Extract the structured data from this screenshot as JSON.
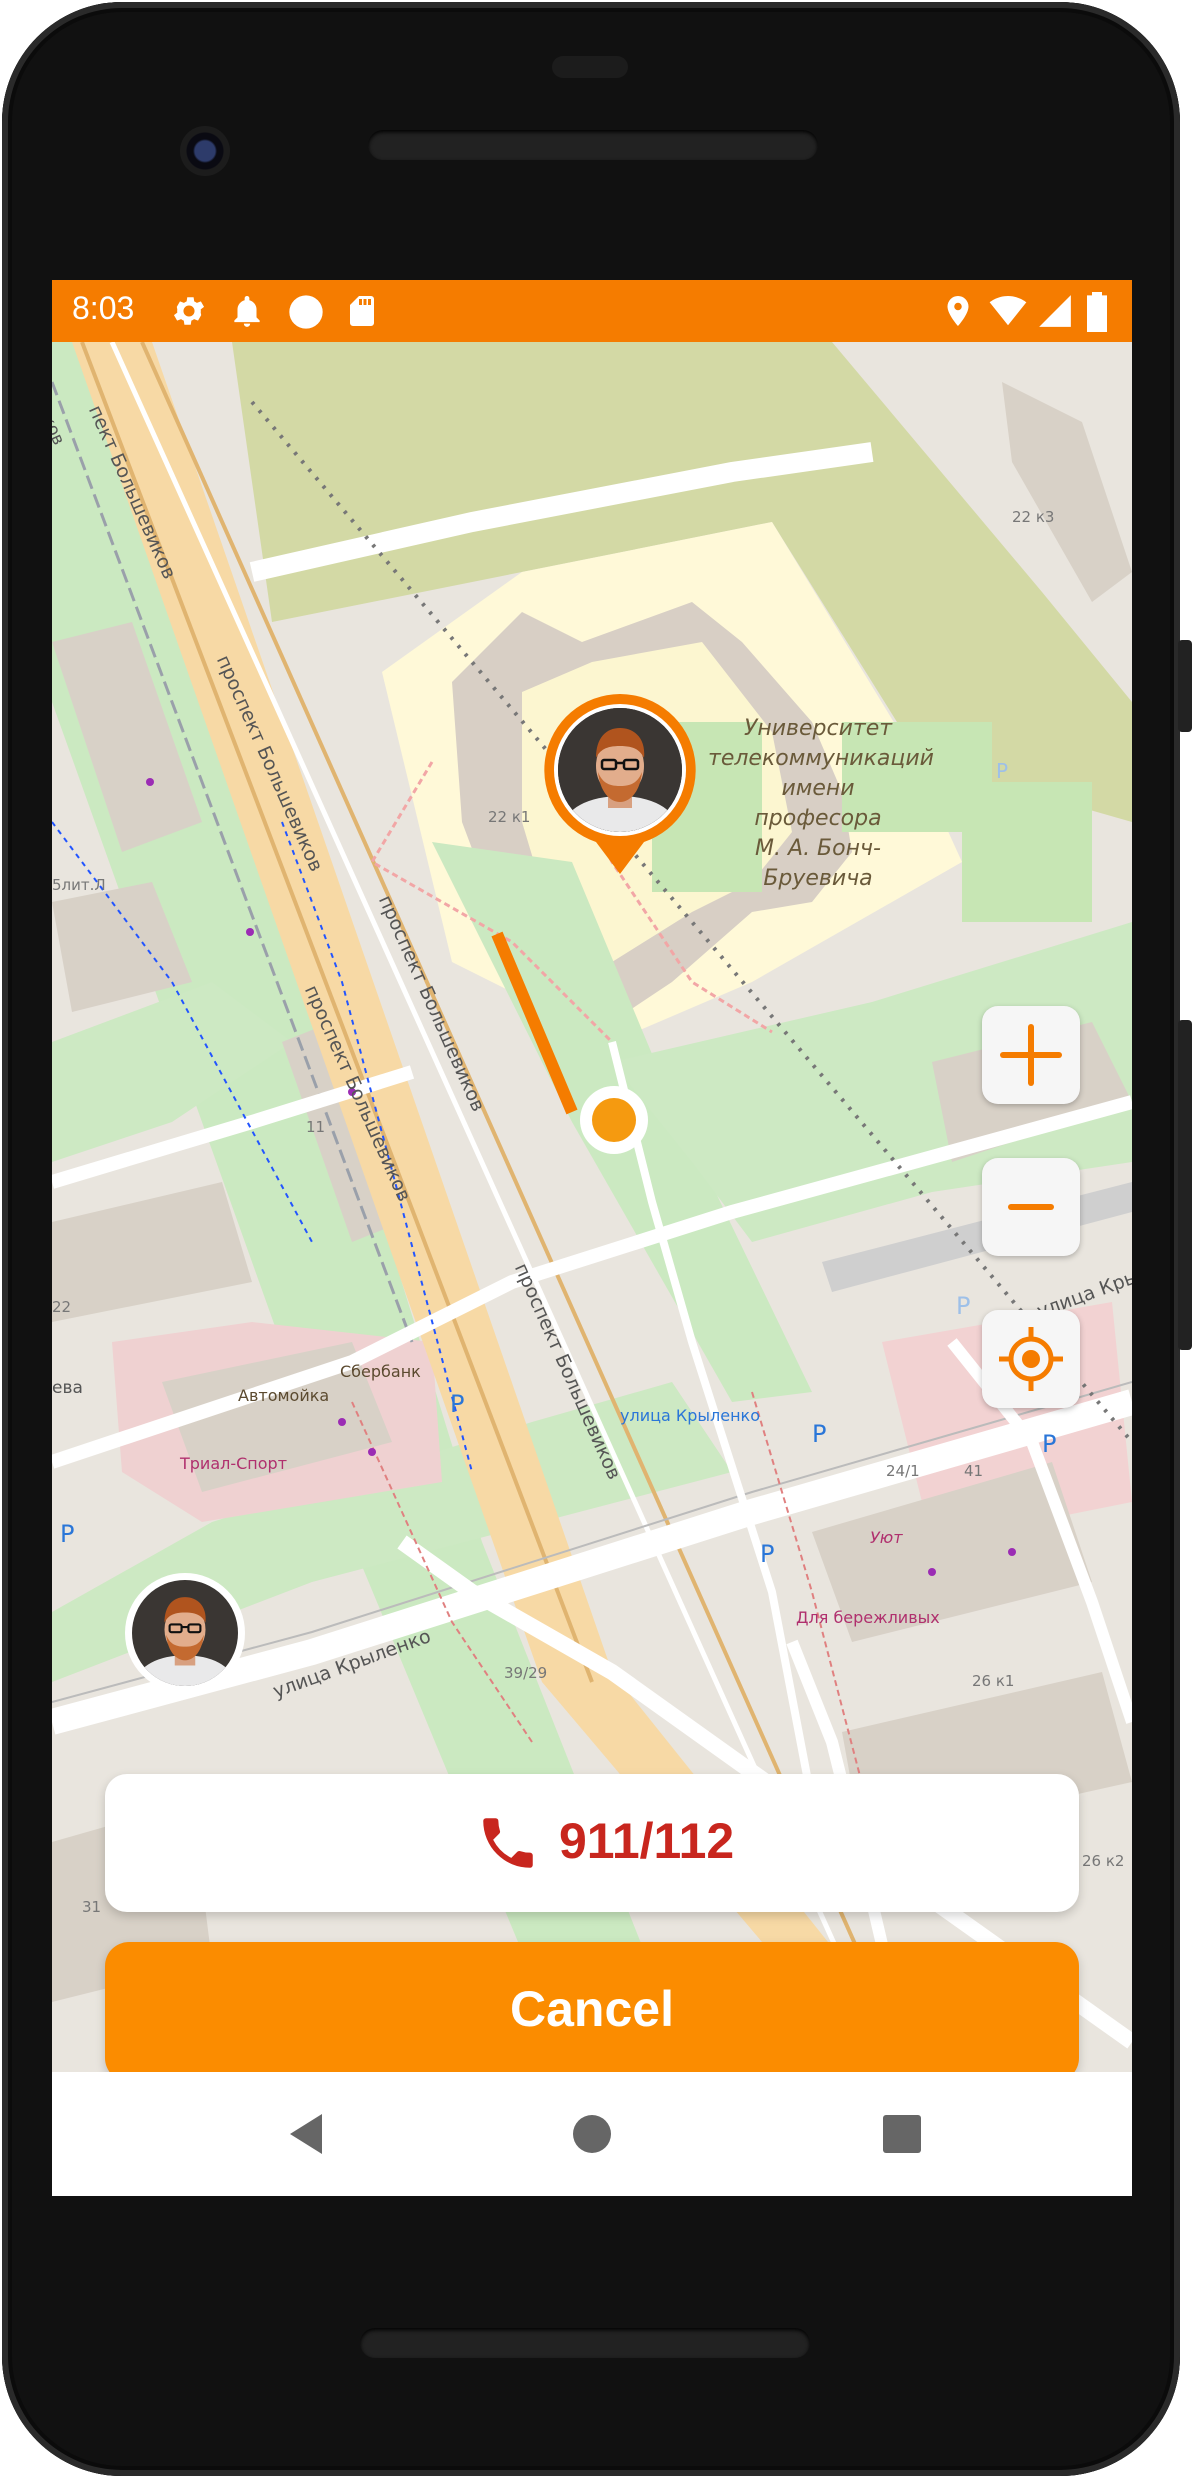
{
  "status_bar": {
    "time": "8:03",
    "left_icons": [
      "gear-icon",
      "bell-icon",
      "circle-icon",
      "sd-card-icon"
    ],
    "right_icons": [
      "location-icon",
      "wifi-icon",
      "signal-icon",
      "battery-icon"
    ],
    "background_color": "#f57c00"
  },
  "map": {
    "poi_university": [
      "Университет",
      "телекоммуникаций",
      "имени",
      "професора",
      "М. А. Бонч-",
      "Бруевича"
    ],
    "street_labels": {
      "prospekt_1": "проспект Большевиков",
      "prospekt_2": "проспект Большевиков",
      "prospekt_3": "проспект Большевиков",
      "prospekt_4": "проспект Большевиков",
      "prospekt_top": "пект Большевиков",
      "krylenko_1": "улица Крыленко",
      "krylenko_2": "улица Крыленко",
      "krylenko_stop": "улица Крыленко"
    },
    "places": {
      "sberbank": "Сбербанк",
      "avtomoyka": "Автомойка",
      "trial_sport": "Триал-Спорт",
      "uyut": "Уют",
      "dlya_berezhlivyh": "Для бережливых"
    },
    "house_numbers": {
      "n22k3": "22 к3",
      "n22k1": "22 к1",
      "n22": "22",
      "n11": "11",
      "n24_1": "24/1",
      "n41": "41",
      "n39_29": "39/29",
      "n26k1": "26 к1",
      "n26k2": "26 к2",
      "n31": "31",
      "n5lit": "5лит.Л"
    },
    "parking_label": "P",
    "partial_labels": {
      "left_edge": "ева",
      "top_left": "ков"
    },
    "route_color": "#f57c00"
  },
  "controls": {
    "zoom_in_icon": "plus-icon",
    "zoom_out_icon": "minus-icon",
    "locate_icon": "crosshair-icon",
    "accent_color": "#f57c00"
  },
  "actions": {
    "emergency_number": "911/112",
    "emergency_icon": "phone-icon",
    "emergency_color": "#c8261e",
    "cancel_label": "Cancel",
    "cancel_color": "#fb8c00"
  },
  "navigation_bar": {
    "icons": [
      "back-icon",
      "home-icon",
      "recents-icon"
    ]
  }
}
